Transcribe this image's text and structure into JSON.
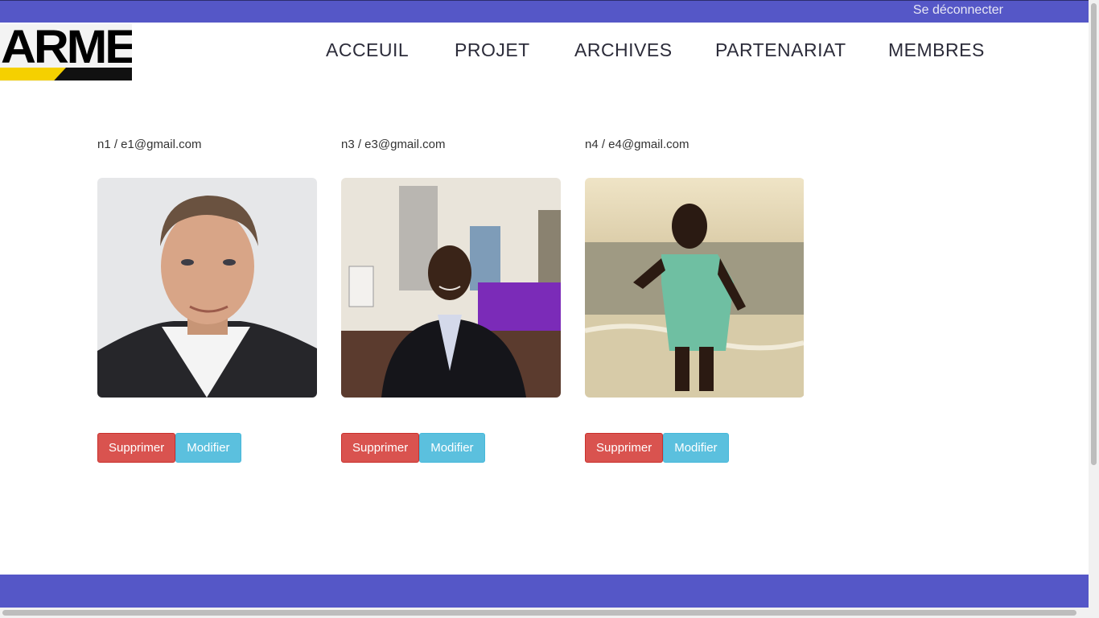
{
  "header": {
    "logout_label": "Se déconnecter",
    "logo_text": "ARME"
  },
  "nav": {
    "items": [
      {
        "label": "ACCEUIL"
      },
      {
        "label": "PROJET"
      },
      {
        "label": "ARCHIVES"
      },
      {
        "label": "PARTENARIAT"
      },
      {
        "label": "MEMBRES"
      }
    ]
  },
  "members": [
    {
      "caption": "n1 / e1@gmail.com",
      "delete_label": "Supprimer",
      "edit_label": "Modifier"
    },
    {
      "caption": "n3 / e3@gmail.com",
      "delete_label": "Supprimer",
      "edit_label": "Modifier"
    },
    {
      "caption": "n4 / e4@gmail.com",
      "delete_label": "Supprimer",
      "edit_label": "Modifier"
    }
  ],
  "colors": {
    "brand": "#5557c7",
    "danger": "#d9534f",
    "info": "#5bc0de",
    "logo_yellow": "#f5d000"
  }
}
